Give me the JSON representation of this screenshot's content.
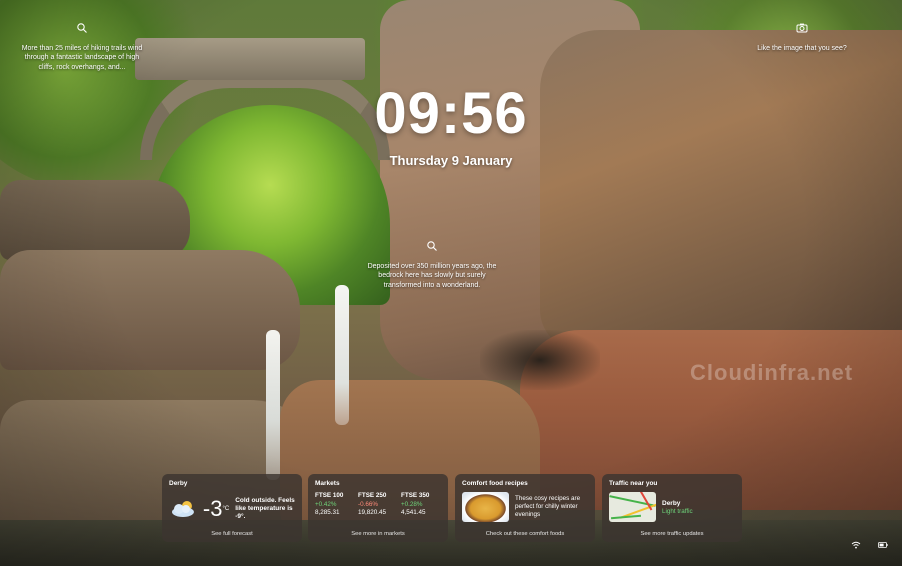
{
  "lockscreen": {
    "time": "09:56",
    "date": "Thursday 9 January",
    "info_left": "More than 25 miles of hiking trails wind through a fantastic landscape of high cliffs, rock overhangs, and...",
    "info_right": "Like the image that you see?",
    "info_center": "Deposited over 350 million years ago, the bedrock here has slowly but surely transformed into a wonderland.",
    "icons": {
      "info_left": "search-icon",
      "info_right": "camera-icon",
      "info_center": "search-icon"
    }
  },
  "watermark": "Cloudinfra.net",
  "widgets": {
    "weather": {
      "title": "Derby",
      "icon": "partly-cloudy-icon",
      "temp": "-3",
      "unit": "°C",
      "description": "Cold outside. Feels like temperature is -9°.",
      "footer": "See full forecast"
    },
    "markets": {
      "title": "Markets",
      "items": [
        {
          "name": "FTSE 100",
          "change": "+0.42%",
          "value": "8,285.31",
          "direction": "up"
        },
        {
          "name": "FTSE 250",
          "change": "-0.66%",
          "value": "19,820.45",
          "direction": "down"
        },
        {
          "name": "FTSE 350",
          "change": "+0.28%",
          "value": "4,541.45",
          "direction": "up"
        }
      ],
      "footer": "See more in markets"
    },
    "recipes": {
      "title": "Comfort food recipes",
      "text": "These cosy recipes are perfect for chilly winter evenings",
      "footer": "Check out these comfort foods"
    },
    "traffic": {
      "title": "Traffic near you",
      "place": "Derby",
      "status": "Light traffic",
      "footer": "See more traffic updates"
    }
  },
  "tray": {
    "icons": [
      "wifi-icon",
      "battery-icon"
    ]
  },
  "colors": {
    "positive": "#6fd47a",
    "negative": "#ff8b7a",
    "widget_bg": "#3c3430"
  }
}
